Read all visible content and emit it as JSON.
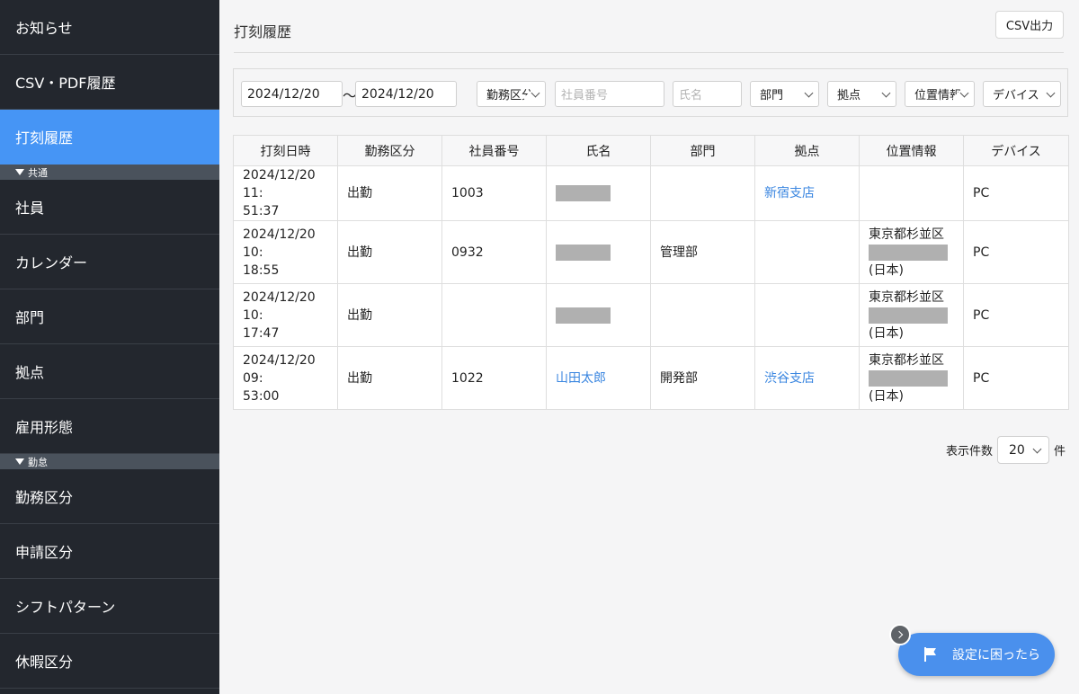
{
  "sidebar": {
    "items": [
      {
        "label": "お知らせ"
      },
      {
        "label": "CSV・PDF履歴"
      },
      {
        "label": "打刻履歴",
        "active": true
      }
    ],
    "group_common": "共通",
    "common_items": [
      {
        "label": "社員"
      },
      {
        "label": "カレンダー"
      },
      {
        "label": "部門"
      },
      {
        "label": "拠点"
      },
      {
        "label": "雇用形態"
      }
    ],
    "group_attendance": "勤怠",
    "attendance_items": [
      {
        "label": "勤務区分"
      },
      {
        "label": "申請区分"
      },
      {
        "label": "シフトパターン"
      },
      {
        "label": "休暇区分"
      }
    ]
  },
  "header": {
    "title": "打刻履歴",
    "csv_button": "CSV出力"
  },
  "filters": {
    "date_from": "2024/12/20",
    "separator": "〜",
    "date_to": "2024/12/20",
    "work_type": "勤務区分",
    "employee_no_placeholder": "社員番号",
    "name_placeholder": "氏名",
    "department": "部門",
    "base": "拠点",
    "location": "位置情報",
    "device": "デバイス"
  },
  "table": {
    "columns": [
      "打刻日時",
      "勤務区分",
      "社員番号",
      "氏名",
      "部門",
      "拠点",
      "位置情報",
      "デバイス"
    ],
    "rows": [
      {
        "datetime_1": "2024/12/20 11:",
        "datetime_2": "51:37",
        "work_type": "出勤",
        "employee_no": "1003",
        "name": "",
        "department": "",
        "base": "新宿支店",
        "loc_1": "",
        "loc_2": "",
        "device": "PC"
      },
      {
        "datetime_1": "2024/12/20 10:",
        "datetime_2": "18:55",
        "work_type": "出勤",
        "employee_no": "0932",
        "name": "",
        "department": "管理部",
        "base": "",
        "loc_1": "東京都杉並区",
        "loc_2": "(日本)",
        "device": "PC"
      },
      {
        "datetime_1": "2024/12/20 10:",
        "datetime_2": "17:47",
        "work_type": "出勤",
        "employee_no": "",
        "name": "",
        "department": "",
        "base": "",
        "loc_1": "東京都杉並区",
        "loc_2": "(日本)",
        "device": "PC"
      },
      {
        "datetime_1": "2024/12/20 09:",
        "datetime_2": "53:00",
        "work_type": "出勤",
        "employee_no": "1022",
        "name": "山田太郎",
        "department": "開発部",
        "base": "渋谷支店",
        "loc_1": "東京都杉並区",
        "loc_2": "(日本)",
        "device": "PC"
      }
    ]
  },
  "pagination": {
    "label": "表示件数",
    "value": "20",
    "unit": "件"
  },
  "help": {
    "label": "設定に困ったら"
  },
  "colors": {
    "sidebar_bg": "#23272e",
    "active": "#4695f5",
    "link": "#3a86e0",
    "help_button": "#4a90ed"
  }
}
